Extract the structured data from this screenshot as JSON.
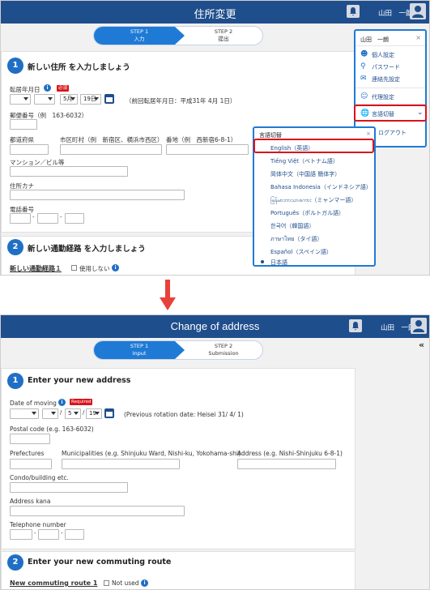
{
  "top": {
    "header_title": "住所変更",
    "user_name": "山田　一朗",
    "steps": [
      {
        "label": "STEP 1",
        "sub": "入力"
      },
      {
        "label": "STEP 2",
        "sub": "提出"
      }
    ],
    "section1": {
      "num": "1",
      "title": "新しい住所 を入力しましょう"
    },
    "move_date_label": "転居年月日",
    "required": "必須",
    "month_value": "5月",
    "day_value": "19日",
    "prev_rotation": "（前回転居年月日：平成31年 4月 1日）",
    "postal_label": "郵便番号（例　163-6032）",
    "pref_label": "都道府県",
    "city_label": "市区町村（例　新宿区、横浜市西区）",
    "addr_label": "番地（例　西新宿6-8-1）",
    "condo_label": "マンション／ビル等",
    "kana_label": "住所カナ",
    "tel_label": "電話番号",
    "section2": {
      "num": "2",
      "title": "新しい通勤経路 を入力しましょう"
    },
    "route_label": "新しい通勤経路１",
    "not_used": "使用しない",
    "menu": {
      "user": "山田　一朗",
      "close": "×",
      "items": [
        "個人設定",
        "パスワード",
        "連絡先設定",
        "代理設定",
        "言語切替"
      ],
      "logout": "ログアウト"
    },
    "lang_popup": {
      "title": "言語切替",
      "close": "×",
      "options": [
        "English（英語）",
        "Tiếng Việt（ベトナム語）",
        "简体中文（中国語 簡体字）",
        "Bahasa Indonesia（インドネシア語）",
        "မြန်မာဘာသာစကား（ミャンマー語）",
        "Português（ポルトガル語）",
        "한국어（韓国語）",
        "ภาษาไทย（タイ語）",
        "Español（スペイン語）",
        "日本語"
      ]
    }
  },
  "bottom": {
    "header_title": "Change of address",
    "user_name": "山田　一朗",
    "steps": [
      {
        "label": "STEP 1",
        "sub": "Input"
      },
      {
        "label": "STEP 2",
        "sub": "Submission"
      }
    ],
    "section1": {
      "num": "1",
      "title": "Enter your new address"
    },
    "move_date_label": "Date of moving",
    "required": "Required",
    "month_value": "5",
    "day_value": "19",
    "prev_rotation": "(Previous rotation date: Heisei 31/ 4/ 1)",
    "postal_label": "Postal code (e.g. 163-6032)",
    "pref_label": "Prefectures",
    "city_label": "Municipalities (e.g. Shinjuku Ward, Nishi-ku, Yokohama-shi)",
    "addr_label": "Address (e.g. Nishi-Shinjuku 6-8-1)",
    "condo_label": "Condo/building etc.",
    "kana_label": "Address kana",
    "tel_label": "Telephone number",
    "section2": {
      "num": "2",
      "title": "Enter your new commuting route"
    },
    "route_label": "New commuting route 1",
    "not_used": "Not used",
    "collapse": "«"
  },
  "colors": {
    "header": "#1f4e8c",
    "accent": "#1f7ad6",
    "highlight": "#d9141c",
    "arrow": "#e8413a"
  }
}
